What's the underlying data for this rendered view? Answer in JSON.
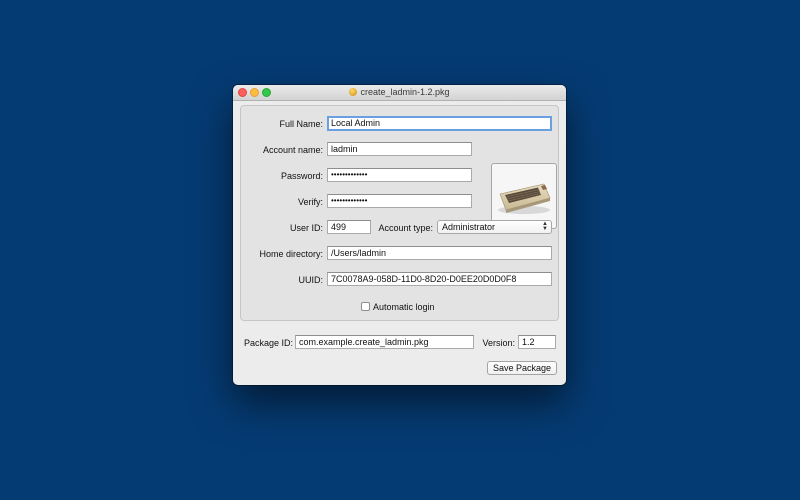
{
  "window": {
    "title": "create_ladmin-1.2.pkg"
  },
  "form": {
    "full_name_label": "Full Name:",
    "full_name_value": "Local Admin",
    "account_name_label": "Account name:",
    "account_name_value": "ladmin",
    "password_label": "Password:",
    "password_value": "•••••••••••••",
    "verify_label": "Verify:",
    "verify_value": "•••••••••••••",
    "user_id_label": "User ID:",
    "user_id_value": "499",
    "account_type_label": "Account type:",
    "account_type_value": "Administrator",
    "home_label": "Home directory:",
    "home_value": "/Users/ladmin",
    "uuid_label": "UUID:",
    "uuid_value": "7C0078A9-058D-11D0-8D20-D0EE20D0D0F8",
    "auto_login_label": "Automatic login",
    "auto_login_checked": false
  },
  "package": {
    "id_label": "Package ID:",
    "id_value": "com.example.create_ladmin.pkg",
    "version_label": "Version:",
    "version_value": "1.2",
    "save_label": "Save Package"
  },
  "icons": {
    "user_picture": "commodore-64-computer-icon",
    "title_icon": "package-icon"
  }
}
